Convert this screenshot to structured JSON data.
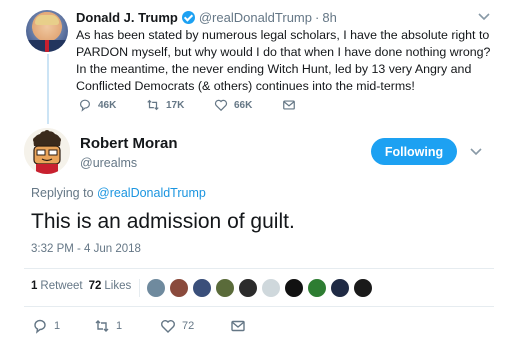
{
  "parent_tweet": {
    "author_name": "Donald J. Trump",
    "author_handle": "@realDonaldTrump",
    "separator": "·",
    "time": "8h",
    "text": "As has been stated by numerous legal scholars, I have the absolute right to PARDON myself, but why would I do that when I have done nothing wrong? In the meantime, the never ending Witch Hunt, led by 13 very Angry and Conflicted Democrats (& others) continues into the mid-terms!",
    "replies": "46K",
    "retweets": "17K",
    "likes": "66K"
  },
  "reply_tweet": {
    "author_name": "Robert Moran",
    "author_handle": "@urealms",
    "follow_label": "Following",
    "replying_prefix": "Replying to",
    "replying_to": "@realDonaldTrump",
    "text": "This is an admission of guilt.",
    "timestamp": "3:32 PM - 4 Jun 2018",
    "retweet_count": "1",
    "retweet_label": "Retweet",
    "like_count": "72",
    "like_label": "Likes",
    "actions": {
      "reply_count": "1",
      "retweet_count": "1",
      "like_count": "72"
    }
  },
  "likers": [
    {
      "name": "liker-avatar-1",
      "color": "#6f8a9e"
    },
    {
      "name": "liker-avatar-2",
      "color": "#8a4a3c"
    },
    {
      "name": "liker-avatar-3",
      "color": "#3a4f7a"
    },
    {
      "name": "liker-avatar-4",
      "color": "#5a6b3a"
    },
    {
      "name": "liker-avatar-5",
      "color": "#2b2b2b"
    },
    {
      "name": "liker-avatar-6",
      "color": "#cfd8dc"
    },
    {
      "name": "liker-avatar-7",
      "color": "#111111"
    },
    {
      "name": "liker-avatar-8",
      "color": "#2e7d32"
    },
    {
      "name": "liker-avatar-9",
      "color": "#1f2a44"
    },
    {
      "name": "liker-avatar-10",
      "color": "#1a1a1a"
    }
  ],
  "colors": {
    "accent": "#1da1f2",
    "link": "#1b95e0",
    "muted": "#657786",
    "thread_line": "#cce4f5"
  }
}
